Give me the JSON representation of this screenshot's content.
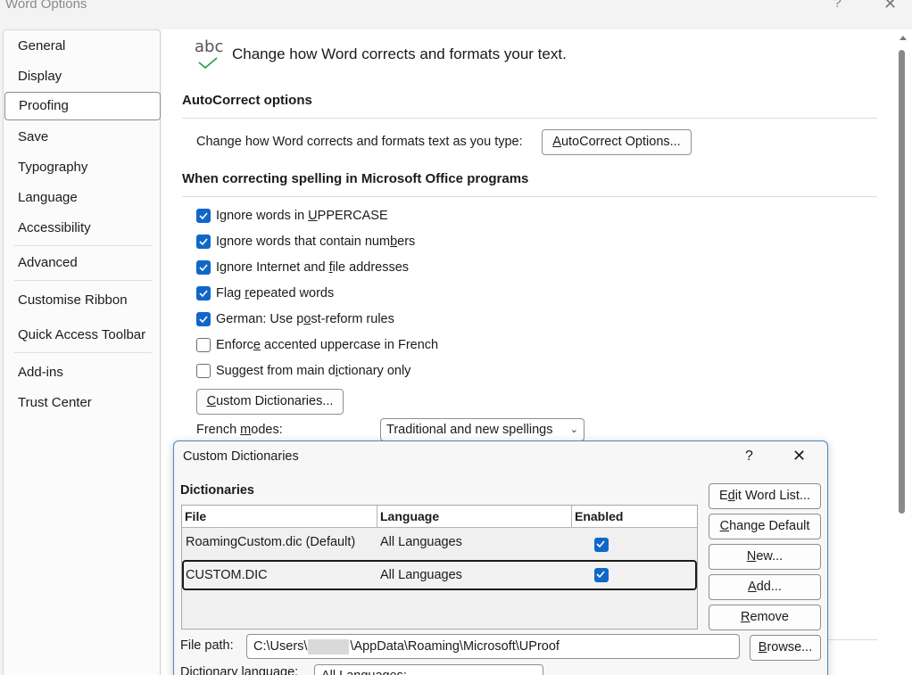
{
  "window": {
    "title": "Word Options",
    "help": "?",
    "close": "✕"
  },
  "nav": {
    "items": [
      {
        "label": "General"
      },
      {
        "label": "Display"
      },
      {
        "label": "Proofing"
      },
      {
        "label": "Save"
      },
      {
        "label": "Typography"
      },
      {
        "label": "Language"
      },
      {
        "label": "Accessibility"
      },
      {
        "label": "Advanced"
      },
      {
        "label": "Customise Ribbon"
      },
      {
        "label": "Quick Access Toolbar"
      },
      {
        "label": "Add-ins"
      },
      {
        "label": "Trust Center"
      }
    ],
    "selected": "Proofing"
  },
  "header": {
    "icon_text": "abc",
    "text": "Change how Word corrects and formats your text."
  },
  "autocorrect": {
    "heading": "AutoCorrect options",
    "description": "Change how Word corrects and formats text as you type:",
    "button": {
      "pre": "",
      "u": "A",
      "post": "utoCorrect Options..."
    }
  },
  "spelling": {
    "heading": "When correcting spelling in Microsoft Office programs",
    "options": [
      {
        "pre": "Ignore words in ",
        "u": "U",
        "post": "PPERCASE",
        "checked": true
      },
      {
        "pre": "Ignore words that contain num",
        "u": "b",
        "post": "ers",
        "checked": true
      },
      {
        "pre": "Ignore Internet and ",
        "u": "f",
        "post": "ile addresses",
        "checked": true
      },
      {
        "pre": "Flag ",
        "u": "r",
        "post": "epeated words",
        "checked": true
      },
      {
        "pre": "German: Use p",
        "u": "o",
        "post": "st-reform rules",
        "checked": true
      },
      {
        "pre": "Enforc",
        "u": "e",
        "post": " accented uppercase in French",
        "checked": false
      },
      {
        "pre": "Suggest from main d",
        "u": "i",
        "post": "ctionary only",
        "checked": false
      }
    ],
    "custom_dict_button": {
      "pre": "",
      "u": "C",
      "post": "ustom Dictionaries..."
    },
    "french_modes": {
      "pre": "French ",
      "u": "m",
      "post": "odes:",
      "value": "Traditional and new spellings"
    }
  },
  "dialog": {
    "title": "Custom Dictionaries",
    "help": "?",
    "close": "✕",
    "subheading": "Dictionaries",
    "columns": [
      "File",
      "Language",
      "Enabled"
    ],
    "rows": [
      {
        "file": "RoamingCustom.dic (Default)",
        "language": "All Languages",
        "enabled": true
      },
      {
        "file": "CUSTOM.DIC",
        "language": "All Languages",
        "enabled": true
      }
    ],
    "buttons": [
      {
        "pre": "E",
        "u": "d",
        "post": "it Word List..."
      },
      {
        "pre": "",
        "u": "C",
        "post": "hange Default"
      },
      {
        "pre": "",
        "u": "N",
        "post": "ew..."
      },
      {
        "pre": "",
        "u": "A",
        "post": "dd..."
      },
      {
        "pre": "",
        "u": "R",
        "post": "emove"
      }
    ],
    "file_path_label": "File path:",
    "file_path_pre": "C:\\Users\\",
    "file_path_post": "\\AppData\\Roaming\\Microsoft\\UProof",
    "browse_button": {
      "pre": "",
      "u": "B",
      "post": "rowse..."
    },
    "dict_language_label": "Dictionary language:",
    "dict_language_value": "All Languages:"
  },
  "colors": {
    "accent": "#1067c8",
    "dialog_border": "#4a86c8",
    "selected_border": "#1b1b1b"
  }
}
